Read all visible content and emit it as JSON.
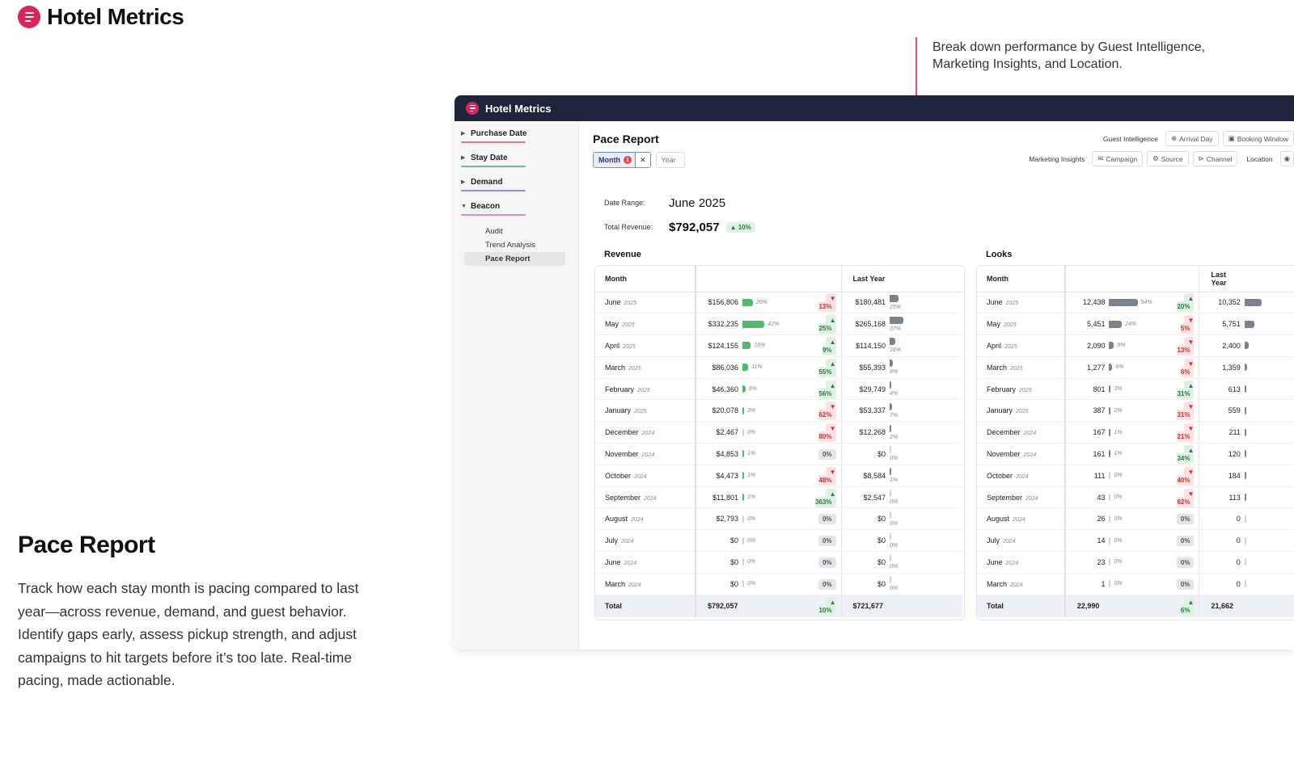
{
  "brand": {
    "name": "Hotel Metrics"
  },
  "callout": "Break down performance by Guest Intelligence, Marketing Insights, and Location.",
  "feature": {
    "title": "Pace Report",
    "body": "Track how each stay month is pacing compared to last year—across revenue, demand, and guest behavior. Identify gaps early, assess pickup strength, and adjust campaigns to hit targets before it’s too late. Real-time pacing, made actionable."
  },
  "app": {
    "title": "Hotel Metrics",
    "sidebar": {
      "groups": [
        {
          "label": "Purchase Date",
          "color": "#e2788f"
        },
        {
          "label": "Stay Date",
          "color": "#6cc08a"
        },
        {
          "label": "Demand",
          "color": "#8d8fe6"
        },
        {
          "label": "Beacon",
          "color": "#d98ad8"
        }
      ],
      "subitems": [
        "Audit",
        "Trend Analysis",
        "Pace Report"
      ]
    },
    "page_title": "Pace Report",
    "chips": {
      "month": "Month",
      "month_badge": "1",
      "year": "Year"
    },
    "filters": {
      "guest_label": "Guest Intelligence",
      "arrival_day": "Arrival Day",
      "booking_window": "Booking Window",
      "marketing_label": "Marketing Insights",
      "campaign": "Campaign",
      "source": "Source",
      "channel": "Channel",
      "location_label": "Location"
    },
    "summary": {
      "date_range_label": "Date Range:",
      "date_range": "June 2025",
      "total_revenue_label": "Total Revenue:",
      "total_revenue": "$792,057",
      "total_change": "▲ 10%"
    },
    "revenue": {
      "title": "Revenue",
      "col_month": "Month",
      "col_last_year": "Last Year",
      "rows": [
        {
          "month": "June",
          "year": "2025",
          "value": "$156,806",
          "share": 20,
          "share_label": "20%",
          "change": "▼ 13%",
          "dir": "down",
          "ly": "$180,481",
          "ly_share": 25,
          "ly_share_label": "25%"
        },
        {
          "month": "May",
          "year": "2025",
          "value": "$332,235",
          "share": 42,
          "share_label": "42%",
          "change": "▲ 25%",
          "dir": "up",
          "ly": "$265,168",
          "ly_share": 37,
          "ly_share_label": "37%"
        },
        {
          "month": "April",
          "year": "2025",
          "value": "$124,155",
          "share": 16,
          "share_label": "16%",
          "change": "▲ 9%",
          "dir": "up",
          "ly": "$114,150",
          "ly_share": 16,
          "ly_share_label": "16%"
        },
        {
          "month": "March",
          "year": "2025",
          "value": "$86,036",
          "share": 11,
          "share_label": "11%",
          "change": "▲ 55%",
          "dir": "up",
          "ly": "$55,393",
          "ly_share": 8,
          "ly_share_label": "8%"
        },
        {
          "month": "February",
          "year": "2025",
          "value": "$46,360",
          "share": 6,
          "share_label": "6%",
          "change": "▲ 56%",
          "dir": "up",
          "ly": "$29,749",
          "ly_share": 4,
          "ly_share_label": "4%"
        },
        {
          "month": "January",
          "year": "2025",
          "value": "$20,078",
          "share": 3,
          "share_label": "3%",
          "change": "▼ 62%",
          "dir": "down",
          "ly": "$53,337",
          "ly_share": 7,
          "ly_share_label": "7%"
        },
        {
          "month": "December",
          "year": "2024",
          "value": "$2,467",
          "share": 0,
          "share_label": "0%",
          "change": "▼ 80%",
          "dir": "down",
          "ly": "$12,268",
          "ly_share": 2,
          "ly_share_label": "2%"
        },
        {
          "month": "November",
          "year": "2024",
          "value": "$4,853",
          "share": 1,
          "share_label": "1%",
          "change": "0%",
          "dir": "zero",
          "ly": "$0",
          "ly_share": 0,
          "ly_share_label": "0%"
        },
        {
          "month": "October",
          "year": "2024",
          "value": "$4,473",
          "share": 1,
          "share_label": "1%",
          "change": "▼ 48%",
          "dir": "down",
          "ly": "$8,584",
          "ly_share": 1,
          "ly_share_label": "1%"
        },
        {
          "month": "September",
          "year": "2024",
          "value": "$11,801",
          "share": 1,
          "share_label": "1%",
          "change": "▲ 363%",
          "dir": "up",
          "ly": "$2,547",
          "ly_share": 0,
          "ly_share_label": "0%"
        },
        {
          "month": "August",
          "year": "2024",
          "value": "$2,793",
          "share": 0,
          "share_label": "0%",
          "change": "0%",
          "dir": "zero",
          "ly": "$0",
          "ly_share": 0,
          "ly_share_label": "0%"
        },
        {
          "month": "July",
          "year": "2024",
          "value": "$0",
          "share": 0,
          "share_label": "0%",
          "change": "0%",
          "dir": "zero",
          "ly": "$0",
          "ly_share": 0,
          "ly_share_label": "0%"
        },
        {
          "month": "June",
          "year": "2024",
          "value": "$0",
          "share": 0,
          "share_label": "0%",
          "change": "0%",
          "dir": "zero",
          "ly": "$0",
          "ly_share": 0,
          "ly_share_label": "0%"
        },
        {
          "month": "March",
          "year": "2024",
          "value": "$0",
          "share": 0,
          "share_label": "0%",
          "change": "0%",
          "dir": "zero",
          "ly": "$0",
          "ly_share": 0,
          "ly_share_label": "0%"
        }
      ],
      "total": {
        "label": "Total",
        "value": "$792,057",
        "change": "▲ 10%",
        "dir": "up",
        "ly": "$721,677"
      }
    },
    "looks": {
      "title": "Looks",
      "col_month": "Month",
      "col_last_year": "Last Year",
      "rows": [
        {
          "month": "June",
          "year": "2025",
          "value": "12,438",
          "share": 54,
          "share_label": "54%",
          "change": "▲ 20%",
          "dir": "up",
          "ly": "10,352",
          "ly_share": 48
        },
        {
          "month": "May",
          "year": "2025",
          "value": "5,451",
          "share": 24,
          "share_label": "24%",
          "change": "▼ 5%",
          "dir": "down",
          "ly": "5,751",
          "ly_share": 27
        },
        {
          "month": "April",
          "year": "2025",
          "value": "2,090",
          "share": 9,
          "share_label": "9%",
          "change": "▼ 13%",
          "dir": "down",
          "ly": "2,400",
          "ly_share": 11
        },
        {
          "month": "March",
          "year": "2025",
          "value": "1,277",
          "share": 6,
          "share_label": "6%",
          "change": "▼ 6%",
          "dir": "down",
          "ly": "1,359",
          "ly_share": 6
        },
        {
          "month": "February",
          "year": "2025",
          "value": "801",
          "share": 3,
          "share_label": "3%",
          "change": "▲ 31%",
          "dir": "up",
          "ly": "613",
          "ly_share": 3
        },
        {
          "month": "January",
          "year": "2025",
          "value": "387",
          "share": 2,
          "share_label": "2%",
          "change": "▼ 31%",
          "dir": "down",
          "ly": "559",
          "ly_share": 3
        },
        {
          "month": "December",
          "year": "2024",
          "value": "167",
          "share": 1,
          "share_label": "1%",
          "change": "▼ 21%",
          "dir": "down",
          "ly": "211",
          "ly_share": 1
        },
        {
          "month": "November",
          "year": "2024",
          "value": "161",
          "share": 1,
          "share_label": "1%",
          "change": "▲ 34%",
          "dir": "up",
          "ly": "120",
          "ly_share": 1
        },
        {
          "month": "October",
          "year": "2024",
          "value": "111",
          "share": 0,
          "share_label": "0%",
          "change": "▼ 40%",
          "dir": "down",
          "ly": "184",
          "ly_share": 1
        },
        {
          "month": "September",
          "year": "2024",
          "value": "43",
          "share": 0,
          "share_label": "0%",
          "change": "▼ 62%",
          "dir": "down",
          "ly": "113",
          "ly_share": 1
        },
        {
          "month": "August",
          "year": "2024",
          "value": "26",
          "share": 0,
          "share_label": "0%",
          "change": "0%",
          "dir": "zero",
          "ly": "0",
          "ly_share": 0
        },
        {
          "month": "July",
          "year": "2024",
          "value": "14",
          "share": 0,
          "share_label": "0%",
          "change": "0%",
          "dir": "zero",
          "ly": "0",
          "ly_share": 0
        },
        {
          "month": "June",
          "year": "2024",
          "value": "23",
          "share": 0,
          "share_label": "0%",
          "change": "0%",
          "dir": "zero",
          "ly": "0",
          "ly_share": 0
        },
        {
          "month": "March",
          "year": "2024",
          "value": "1",
          "share": 0,
          "share_label": "0%",
          "change": "0%",
          "dir": "zero",
          "ly": "0",
          "ly_share": 0
        }
      ],
      "total": {
        "label": "Total",
        "value": "22,990",
        "change": "▲ 6%",
        "dir": "up",
        "ly": "21,662"
      }
    }
  }
}
